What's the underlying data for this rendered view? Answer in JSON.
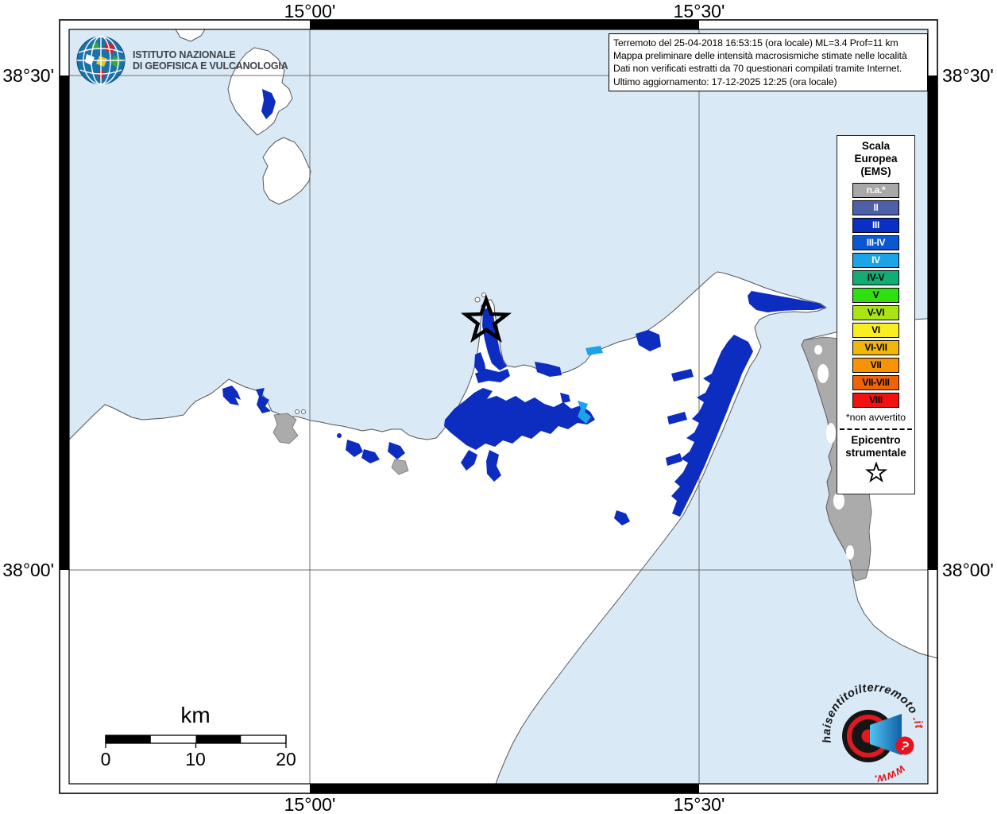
{
  "axis": {
    "top": [
      "15°00'",
      "15°30'"
    ],
    "bottom": [
      "15°00'",
      "15°30'"
    ],
    "left": [
      "38°30'",
      "38°00'"
    ],
    "right": [
      "38°30'",
      "38°00'"
    ]
  },
  "ingv": {
    "name_line1": "ISTITUTO NAZIONALE",
    "name_line2": "DI GEOFISICA E VULCANOLOGIA"
  },
  "info_box": {
    "lines": [
      "Terremoto del 25-04-2018 16:53:15 (ora locale) ML=3.4 Prof=11 km",
      "Mappa preliminare delle intensità macrosismiche stimate nelle località",
      "Dati non verificati estratti da 70 questionari compilati tramite Internet.",
      "Ultimo aggiornamento: 17-12-2025 12:25 (ora locale)"
    ]
  },
  "legend": {
    "title_lines": [
      "Scala",
      "Europea",
      "(EMS)"
    ],
    "items": [
      {
        "label": "n.a.*",
        "bg": "#a8a8a8",
        "fg": "#ffffff"
      },
      {
        "label": "II",
        "bg": "#4d5fa8",
        "fg": "#ffffff"
      },
      {
        "label": "III",
        "bg": "#0a2fc4",
        "fg": "#ffffff"
      },
      {
        "label": "III-IV",
        "bg": "#0b57d2",
        "fg": "#ffffff"
      },
      {
        "label": "IV",
        "bg": "#1ba4e8",
        "fg": "#ffffff"
      },
      {
        "label": "IV-V",
        "bg": "#12ad74",
        "fg": "#000000"
      },
      {
        "label": "V",
        "bg": "#30df10",
        "fg": "#000000"
      },
      {
        "label": "V-VI",
        "bg": "#a9e414",
        "fg": "#000000"
      },
      {
        "label": "VI",
        "bg": "#f8ee20",
        "fg": "#000000"
      },
      {
        "label": "VI-VII",
        "bg": "#f2b606",
        "fg": "#000000"
      },
      {
        "label": "VII",
        "bg": "#f79405",
        "fg": "#000000"
      },
      {
        "label": "VII-VIII",
        "bg": "#ee6402",
        "fg": "#000000"
      },
      {
        "label": "VIII",
        "bg": "#f01111",
        "fg": "#000000"
      }
    ],
    "footnote": "*non avvertito",
    "epicenter_lines": [
      "Epicentro",
      "strumentale"
    ]
  },
  "scalebar": {
    "unit": "km",
    "ticks": [
      "0",
      "10",
      "20"
    ]
  },
  "map": {
    "sea_color": "#d9e9f6",
    "land_color": "#ffffff",
    "intensity_iii_color": "#0d2cc0",
    "intensity_iv_color": "#1ba4e8",
    "na_area_color": "#ababab",
    "epicenter_symbol": "star"
  },
  "watermark": {
    "arc_main": "haisentitoilterremoto",
    "arc_suffix": ".it",
    "bottom_text": "www.",
    "question_mark": "?"
  }
}
